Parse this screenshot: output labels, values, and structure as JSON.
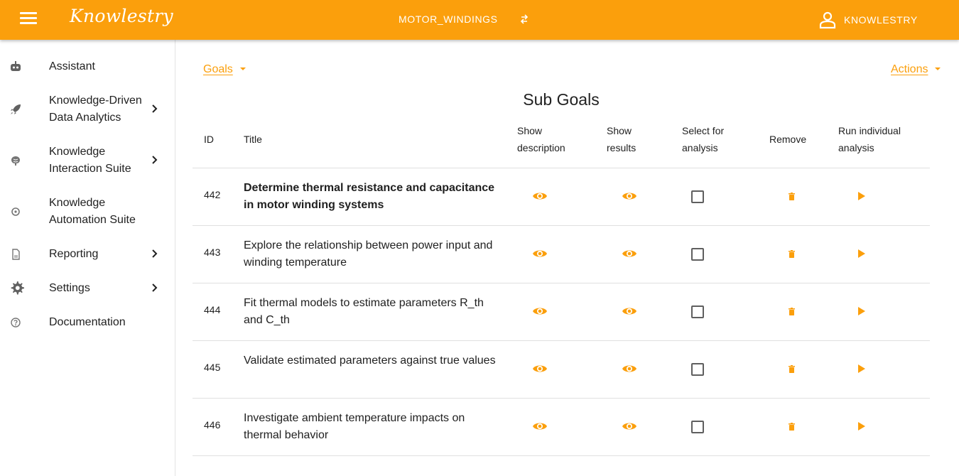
{
  "header": {
    "logo_text": "Knowlestry",
    "project_name": "MOTOR_WINDINGS",
    "user_name": "KNOWLESTRY",
    "accent_color": "#fb9f0c"
  },
  "sidebar": {
    "items": [
      {
        "label": "Assistant",
        "icon": "robot-icon",
        "has_submenu": false
      },
      {
        "label": "Knowledge-Driven Data Analytics",
        "icon": "rocket-icon",
        "has_submenu": true
      },
      {
        "label": "Knowledge Interaction Suite",
        "icon": "brain-icon",
        "has_submenu": true
      },
      {
        "label": "Knowledge Automation Suite",
        "icon": "cog-automation-icon",
        "has_submenu": false
      },
      {
        "label": "Reporting",
        "icon": "document-icon",
        "has_submenu": true
      },
      {
        "label": "Settings",
        "icon": "gear-icon",
        "has_submenu": true
      },
      {
        "label": "Documentation",
        "icon": "help-circle-icon",
        "has_submenu": false
      }
    ]
  },
  "toolbar": {
    "goals_label": "Goals",
    "actions_label": "Actions"
  },
  "main": {
    "title": "Sub Goals",
    "columns": [
      "ID",
      "Title",
      "Show description",
      "Show results",
      "Select for analysis",
      "Remove",
      "Run individual analysis"
    ],
    "rows": [
      {
        "id": "442",
        "title": "Determine thermal resistance and capacitance in motor winding systems",
        "bold": true,
        "selected": false
      },
      {
        "id": "443",
        "title": "Explore the relationship between power input and winding temperature",
        "bold": false,
        "selected": false
      },
      {
        "id": "444",
        "title": "Fit thermal models to estimate parameters R_th and C_th",
        "bold": false,
        "selected": false
      },
      {
        "id": "445",
        "title": "Validate estimated parameters against true values",
        "bold": false,
        "selected": false
      },
      {
        "id": "446",
        "title": "Investigate ambient temperature impacts on thermal behavior",
        "bold": false,
        "selected": false
      }
    ]
  }
}
